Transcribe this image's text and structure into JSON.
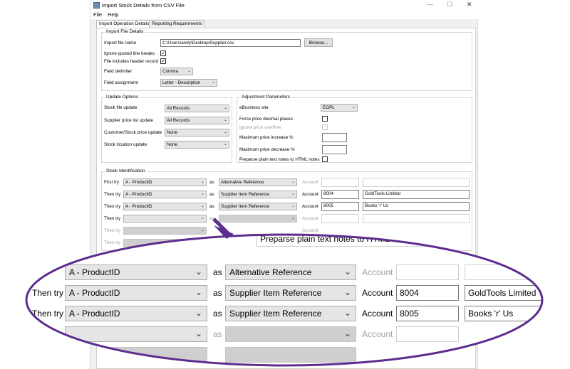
{
  "window": {
    "title": "Import Stock Details from CSV File"
  },
  "menu": [
    "File",
    "Help"
  ],
  "tabs": [
    "Import Operation Details",
    "Reporting Requirements"
  ],
  "import_file": {
    "group_title": "Import File Details",
    "file_name_label": "Import file name",
    "file_name_value": "C:\\Users\\andy\\Desktop\\Supplier.csv",
    "browse_label": "Browse...",
    "ignore_quoted_label": "Ignore quoted line breaks",
    "header_record_label": "File includes header record",
    "delimiter_label": "Field delimiter",
    "delimiter_value": "Comma",
    "assignment_label": "Field assignment",
    "assignment_value": "Letter - Description"
  },
  "update_options": {
    "group_title": "Update Options",
    "rows": [
      {
        "label": "Stock file update",
        "value": "All Records"
      },
      {
        "label": "Supplier price list update",
        "value": "All Records"
      },
      {
        "label": "Customer/Stock price update",
        "value": "None"
      },
      {
        "label": "Stock location update",
        "value": "None"
      }
    ]
  },
  "adjustment": {
    "group_title": "Adjustment Parameters",
    "ebusiness_label": "eBusiness site",
    "ebusiness_value": "EGPL",
    "force_decimal_label": "Force price decimal places",
    "ignore_overflow_label": "Ignore price overflow",
    "max_increase_label": "Maximum price increase %",
    "max_decrease_label": "Maximum price decrease %",
    "prepare_notes_label": "Preparse plain text notes to HTML notes"
  },
  "stock_id": {
    "group_title": "Stock Identification",
    "as_label": "as",
    "account_label": "Account",
    "rows": [
      {
        "label": "First try",
        "field": "A - ProductID",
        "ref": "Alternative Reference",
        "account": "",
        "name": ""
      },
      {
        "label": "Then try",
        "field": "A - ProductID",
        "ref": "Supplier Item Reference",
        "account": "8004",
        "name": "GoldTools Limited"
      },
      {
        "label": "Then try",
        "field": "A - ProductID",
        "ref": "Supplier Item Reference",
        "account": "8005",
        "name": "Books 'r' Us"
      },
      {
        "label": "Then try",
        "field": "",
        "ref": "",
        "account": "",
        "name": ""
      },
      {
        "label": "Then try",
        "field": "",
        "ref": "",
        "account": "",
        "name": ""
      },
      {
        "label": "Then try",
        "field": "",
        "ref": "",
        "account": "",
        "name": ""
      }
    ]
  },
  "zoom": {
    "partial_title": "ation",
    "prepare_text": "Preparse plain text notes to HTML no",
    "first_try_partial": "t try"
  },
  "colors": {
    "accent_purple": "#5b2d8e"
  }
}
